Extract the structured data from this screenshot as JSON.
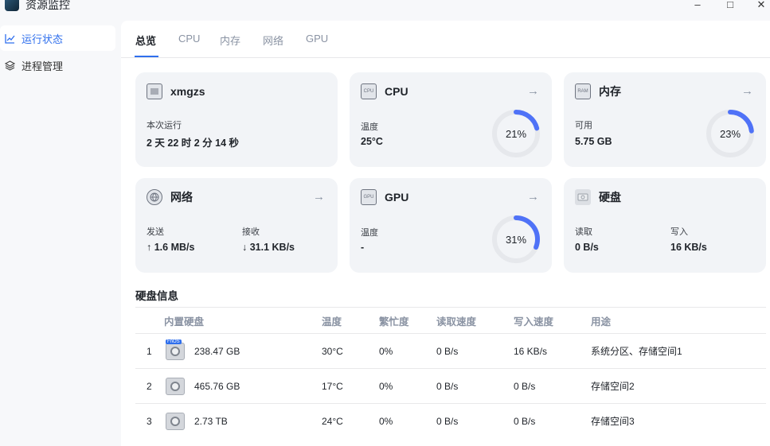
{
  "window": {
    "title": "资源监控",
    "minimize": "–",
    "maximize": "□",
    "close": "✕"
  },
  "sidebar": {
    "items": [
      {
        "label": "运行状态",
        "icon": "line-chart-icon",
        "active": true
      },
      {
        "label": "进程管理",
        "icon": "layers-icon",
        "active": false
      }
    ]
  },
  "tabs": [
    {
      "label": "总览",
      "active": true
    },
    {
      "label": "CPU",
      "active": false
    },
    {
      "label": "内存",
      "active": false
    },
    {
      "label": "网络",
      "active": false
    },
    {
      "label": "GPU",
      "active": false
    }
  ],
  "cards": {
    "host": {
      "title": "xmgzs",
      "label": "本次运行",
      "value": "2 天 22 时 2 分 14 秒"
    },
    "cpu": {
      "title": "CPU",
      "icon_text": "CPU",
      "label": "温度",
      "value": "25°C",
      "percent_text": "21%",
      "percent": 21
    },
    "memory": {
      "title": "内存",
      "icon_text": "RAM",
      "label": "可用",
      "value": "5.75 GB",
      "percent_text": "23%",
      "percent": 23
    },
    "network": {
      "title": "网络",
      "send_label": "发送",
      "send_value": "↑ 1.6 MB/s",
      "recv_label": "接收",
      "recv_value": "↓ 31.1 KB/s"
    },
    "gpu": {
      "title": "GPU",
      "icon_text": "GPU",
      "label": "温度",
      "value": "-",
      "percent_text": "31%",
      "percent": 31
    },
    "disk": {
      "title": "硬盘",
      "read_label": "读取",
      "read_value": "0 B/s",
      "write_label": "写入",
      "write_value": "16 KB/s"
    }
  },
  "arrow": "→",
  "disk_section": {
    "title": "硬盘信息",
    "headers": {
      "disk": "内置硬盘",
      "temp": "温度",
      "busy": "繁忙度",
      "read": "读取速度",
      "write": "写入速度",
      "usage": "用途"
    },
    "ssd_tag": "FnOS",
    "rows": [
      {
        "index": "1",
        "size": "238.47 GB",
        "temp": "30°C",
        "busy": "0%",
        "read": "0 B/s",
        "write": "16 KB/s",
        "usage": "系统分区、存储空间1"
      },
      {
        "index": "2",
        "size": "465.76 GB",
        "temp": "17°C",
        "busy": "0%",
        "read": "0 B/s",
        "write": "0 B/s",
        "usage": "存储空间2"
      },
      {
        "index": "3",
        "size": "2.73 TB",
        "temp": "24°C",
        "busy": "0%",
        "read": "0 B/s",
        "write": "0 B/s",
        "usage": "存储空间3"
      }
    ]
  },
  "colors": {
    "accent": "#2f6fed",
    "gauge_track": "#e6e8ec",
    "gauge_fill": "#4f72f7"
  }
}
